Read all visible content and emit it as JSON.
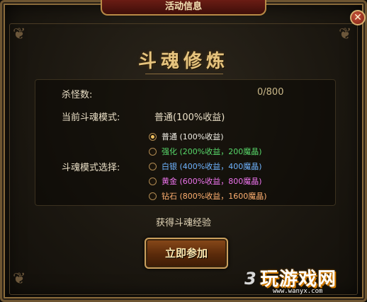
{
  "window": {
    "title": "活动信息",
    "close_glyph": "✕"
  },
  "header": {
    "title": "斗魂修炼"
  },
  "stats": {
    "kill_label": "杀怪数:",
    "kill_value": "0/800",
    "mode_label": "当前斗魂模式:",
    "mode_value": "普通(100%收益)"
  },
  "mode_select": {
    "label": "斗魂模式选择:",
    "options": [
      {
        "label": "普通 (100%收益)",
        "color": "#f2efe6",
        "selected": true
      },
      {
        "label": "强化 (200%收益，200魔晶)",
        "color": "#58d86a",
        "selected": false
      },
      {
        "label": "白银 (400%收益，400魔晶)",
        "color": "#6fb4ff",
        "selected": false
      },
      {
        "label": "黄金 (600%收益，800魔晶)",
        "color": "#ee74ee",
        "selected": false
      },
      {
        "label": "钻石 (800%收益，1600魔晶)",
        "color": "#ffb070",
        "selected": false
      }
    ]
  },
  "footer": {
    "exp_text": "获得斗魂经验",
    "join_button": "立即参加"
  },
  "watermark": {
    "main": "玩游戏网",
    "url": "www.wanyx.com",
    "prefix": "3"
  }
}
